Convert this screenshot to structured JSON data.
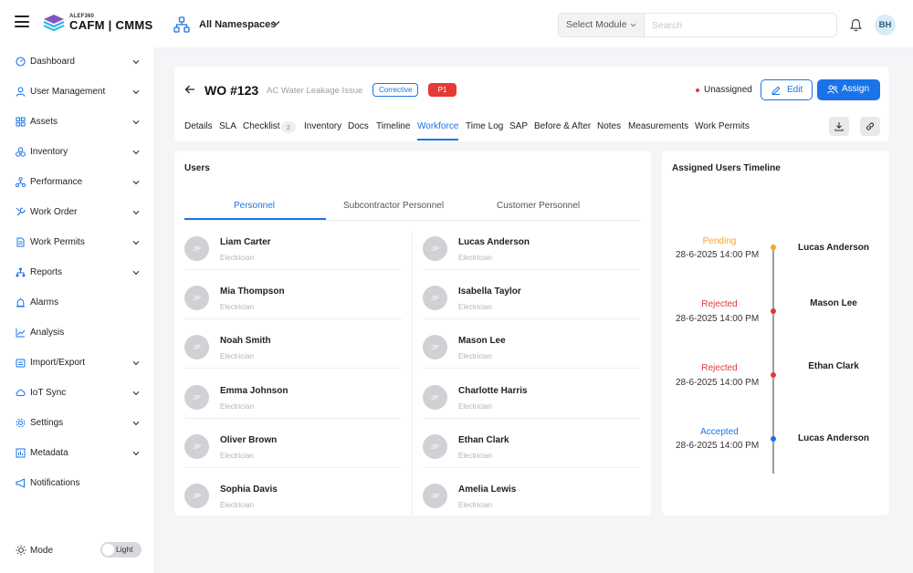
{
  "app": {
    "logo_small": "ALEF360",
    "logo_text": "CAFM | CMMS",
    "namespace": "All Namespaces",
    "module_select": "Select Module",
    "search_placeholder": "Search",
    "user_initials": "BH"
  },
  "sidebar": {
    "items": [
      {
        "label": "Dashboard",
        "icon": "gauge-icon",
        "chevron": true
      },
      {
        "label": "User Management",
        "icon": "user-icon",
        "chevron": true
      },
      {
        "label": "Assets",
        "icon": "grid-icon",
        "chevron": true
      },
      {
        "label": "Inventory",
        "icon": "boxes-icon",
        "chevron": true
      },
      {
        "label": "Performance",
        "icon": "network-icon",
        "chevron": true
      },
      {
        "label": "Work Order",
        "icon": "wrench-icon",
        "chevron": true
      },
      {
        "label": "Work Permits",
        "icon": "document-icon",
        "chevron": true
      },
      {
        "label": "Reports",
        "icon": "hierarchy-icon",
        "chevron": true
      },
      {
        "label": "Alarms",
        "icon": "alarm-icon",
        "chevron": false
      },
      {
        "label": "Analysis",
        "icon": "chart-icon",
        "chevron": false
      },
      {
        "label": "Import/Export",
        "icon": "import-icon",
        "chevron": true
      },
      {
        "label": "IoT Sync",
        "icon": "cloud-icon",
        "chevron": true
      },
      {
        "label": "Settings",
        "icon": "gear-icon",
        "chevron": true
      },
      {
        "label": "Metadata",
        "icon": "bars-icon",
        "chevron": true
      },
      {
        "label": "Notifications",
        "icon": "megaphone-icon",
        "chevron": false
      }
    ],
    "mode_label": "Mode",
    "mode_value": "Light"
  },
  "work_order": {
    "title": "WO #123",
    "subtitle": "AC Water Leakage Issue",
    "type_badge": "Corrective",
    "priority_badge": "P1",
    "status": "Unassigned",
    "edit_label": "Edit",
    "assign_label": "Assign",
    "tabs": [
      "Details",
      "SLA",
      "Checklist",
      "Inventory",
      "Docs",
      "Timeline",
      "Workforce",
      "Time Log",
      "SAP",
      "Before & After",
      "Notes",
      "Measurements",
      "Work Permits"
    ],
    "active_tab": "Workforce",
    "checklist_count": "2"
  },
  "users": {
    "title": "Users",
    "tabs": [
      "Personnel",
      "Subcontractor Personnel",
      "Customer Personnel"
    ],
    "active_tab": "Personnel",
    "left": [
      {
        "initials": "JP",
        "name": "Liam Carter",
        "role": "Electrician"
      },
      {
        "initials": "JP",
        "name": "Mia Thompson",
        "role": "Electrician"
      },
      {
        "initials": "JP",
        "name": "Noah Smith",
        "role": "Electrician"
      },
      {
        "initials": "JP",
        "name": "Emma Johnson",
        "role": "Electrician"
      },
      {
        "initials": "JP",
        "name": "Oliver Brown",
        "role": "Electrician"
      },
      {
        "initials": "JP",
        "name": "Sophia Davis",
        "role": "Electrician"
      }
    ],
    "right": [
      {
        "initials": "JP",
        "name": "Lucas Anderson",
        "role": "Electrician"
      },
      {
        "initials": "JP",
        "name": "Isabella Taylor",
        "role": "Electrician"
      },
      {
        "initials": "JP",
        "name": "Mason Lee",
        "role": "Electrician"
      },
      {
        "initials": "JP",
        "name": "Charlotte Harris",
        "role": "Electrician"
      },
      {
        "initials": "JP",
        "name": "Ethan Clark",
        "role": "Electrician"
      },
      {
        "initials": "JP",
        "name": "Amelia Lewis",
        "role": "Electrician"
      }
    ]
  },
  "timeline": {
    "title": "Assigned Users Timeline",
    "entries": [
      {
        "status": "Pending",
        "color": "#f5a623",
        "datetime": "28-6-2025 14:00 PM",
        "name": "Lucas Anderson"
      },
      {
        "status": "Rejected",
        "color": "#e53935",
        "datetime": "28-6-2025 14:00 PM",
        "name": "Mason Lee"
      },
      {
        "status": "Rejected",
        "color": "#e53935",
        "datetime": "28-6-2025 14:00 PM",
        "name": "Ethan Clark"
      },
      {
        "status": "Accepted",
        "color": "#1a73e8",
        "datetime": "28-6-2025 14:00 PM",
        "name": "Lucas Anderson"
      }
    ]
  },
  "colors": {
    "accent": "#1a73e8",
    "danger": "#e53935",
    "pending": "#f5a623"
  }
}
